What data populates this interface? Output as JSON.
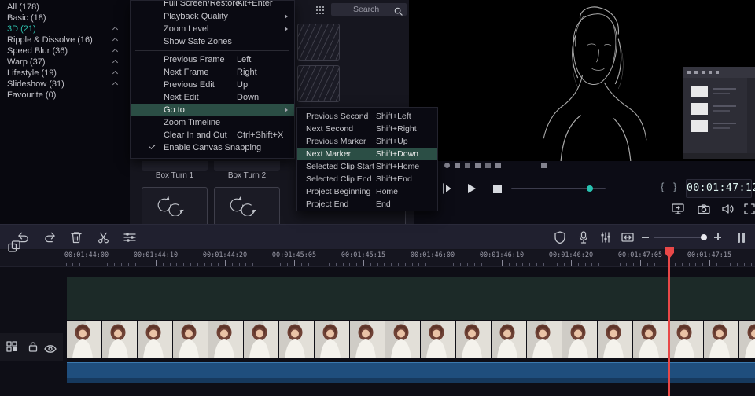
{
  "sidebar": {
    "categories": [
      {
        "label": "All (178)"
      },
      {
        "label": "Basic (18)"
      },
      {
        "label": "3D (21)",
        "selected": true
      },
      {
        "label": "Ripple & Dissolve (16)"
      },
      {
        "label": "Speed Blur (36)"
      },
      {
        "label": "Warp (37)"
      },
      {
        "label": "Lifestyle (19)"
      },
      {
        "label": "Slideshow (31)"
      },
      {
        "label": "Favourite (0)"
      }
    ]
  },
  "search": {
    "placeholder": "Search"
  },
  "view_menu": {
    "clipped_item": {
      "label": "Full Screen/Restore",
      "shortcut": "Alt+Enter"
    },
    "group1": [
      {
        "label": "Playback Quality"
      },
      {
        "label": "Zoom Level"
      },
      {
        "label": "Show Safe Zones"
      }
    ],
    "group2": [
      {
        "label": "Previous Frame",
        "shortcut": "Left"
      },
      {
        "label": "Next Frame",
        "shortcut": "Right"
      },
      {
        "label": "Previous Edit",
        "shortcut": "Up"
      },
      {
        "label": "Next Edit",
        "shortcut": "Down"
      },
      {
        "label": "Go to",
        "highlighted": true
      },
      {
        "label": "Zoom Timeline"
      },
      {
        "label": "Clear In and Out",
        "shortcut": "Ctrl+Shift+X"
      },
      {
        "label": "Enable Canvas Snapping",
        "checked": true
      }
    ]
  },
  "goto_submenu": {
    "items": [
      {
        "label": "Previous Second",
        "shortcut": "Shift+Left"
      },
      {
        "label": "Next Second",
        "shortcut": "Shift+Right"
      },
      {
        "label": "Previous Marker",
        "shortcut": "Shift+Up"
      },
      {
        "label": "Next Marker",
        "shortcut": "Shift+Down",
        "highlighted": true
      },
      {
        "label": "Selected Clip Start",
        "shortcut": "Shift+Home"
      },
      {
        "label": "Selected Clip End",
        "shortcut": "Shift+End"
      },
      {
        "label": "Project Beginning",
        "shortcut": "Home"
      },
      {
        "label": "Project End",
        "shortcut": "End"
      }
    ]
  },
  "transitions": {
    "items": [
      {
        "name": "Box Turn 1"
      },
      {
        "name": "Box Turn 2"
      }
    ]
  },
  "preview": {
    "timecode": "00:01:47:12",
    "mark_in_glyph": "{",
    "mark_out_glyph": "}"
  },
  "timeline": {
    "ruler_labels": [
      "00:01:44:00",
      "00:01:44:10",
      "00:01:44:20",
      "00:01:45:05",
      "00:01:45:15",
      "00:01:46:00",
      "00:01:46:10",
      "00:01:46:20",
      "00:01:47:05",
      "00:01:47:15"
    ]
  },
  "colors": {
    "accent": "#28c3b1",
    "playhead": "#e84848",
    "clip_audio": "#1f4e7d",
    "menu_highlight": "#2b4e45"
  }
}
